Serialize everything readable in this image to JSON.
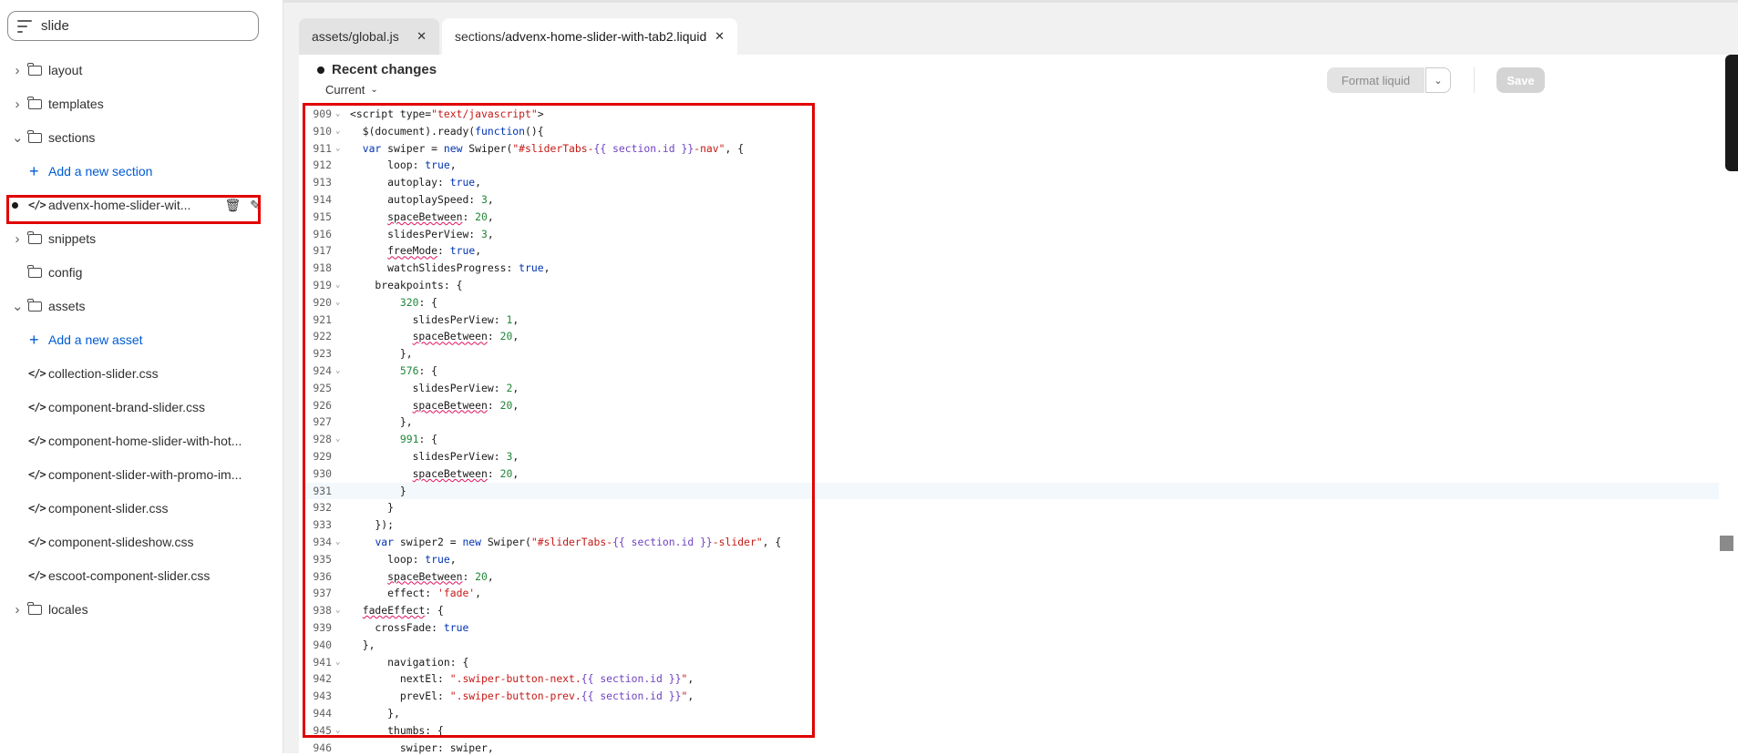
{
  "sidebar": {
    "search_value": "slide",
    "items": [
      {
        "type": "folder",
        "label": "layout",
        "chevron": "›"
      },
      {
        "type": "folder",
        "label": "templates",
        "chevron": "›"
      },
      {
        "type": "folder",
        "label": "sections",
        "chevron": "⌄"
      },
      {
        "type": "add",
        "label": "Add a new section"
      },
      {
        "type": "file",
        "label": "advenx-home-slider-wit..."
      },
      {
        "type": "folder",
        "label": "snippets",
        "chevron": "›"
      },
      {
        "type": "folder",
        "label": "config",
        "chevron": ""
      },
      {
        "type": "folder",
        "label": "assets",
        "chevron": "⌄"
      },
      {
        "type": "add",
        "label": "Add a new asset"
      },
      {
        "type": "file",
        "label": "collection-slider.css"
      },
      {
        "type": "file",
        "label": "component-brand-slider.css"
      },
      {
        "type": "file",
        "label": "component-home-slider-with-hot..."
      },
      {
        "type": "file",
        "label": "component-slider-with-promo-im..."
      },
      {
        "type": "file",
        "label": "component-slider.css"
      },
      {
        "type": "file",
        "label": "component-slideshow.css"
      },
      {
        "type": "file",
        "label": "escoot-component-slider.css"
      },
      {
        "type": "folder",
        "label": "locales",
        "chevron": "›"
      }
    ]
  },
  "tabs": [
    {
      "prefix": "assets/",
      "name": "global.js"
    },
    {
      "prefix": "sections/",
      "name": "advenx-home-slider-with-tab2.liquid"
    }
  ],
  "editor": {
    "recent_changes": "Recent changes",
    "current_label": "Current",
    "format_label": "Format liquid",
    "save_label": "Save"
  },
  "code_lines": [
    {
      "n": "909",
      "fold": true,
      "html": "&lt;script type=<span class='s'>\"text/javascript\"</span>&gt;"
    },
    {
      "n": "910",
      "fold": true,
      "html": "  $(document).ready(<span class='k'>function</span>(){"
    },
    {
      "n": "911",
      "fold": true,
      "html": "  <span class='k'>var</span> swiper = <span class='k'>new</span> Swiper(<span class='s'>\"#sliderTabs-</span><span class='p'>{{ section.id }}</span><span class='s'>-nav\"</span>, {"
    },
    {
      "n": "912",
      "fold": false,
      "html": "      loop: <span class='k'>true</span>,"
    },
    {
      "n": "913",
      "fold": false,
      "html": "      autoplay: <span class='k'>true</span>,"
    },
    {
      "n": "914",
      "fold": false,
      "html": "      autoplaySpeed: <span class='g'>3</span>,"
    },
    {
      "n": "915",
      "fold": false,
      "html": "      <span class='u'>spaceBetween</span>: <span class='g'>20</span>,"
    },
    {
      "n": "916",
      "fold": false,
      "html": "      slidesPerView: <span class='g'>3</span>,"
    },
    {
      "n": "917",
      "fold": false,
      "html": "      <span class='u'>freeMode</span>: <span class='k'>true</span>,"
    },
    {
      "n": "918",
      "fold": false,
      "html": "      watchSlidesProgress: <span class='k'>true</span>,"
    },
    {
      "n": "919",
      "fold": true,
      "html": "    breakpoints: {"
    },
    {
      "n": "920",
      "fold": true,
      "html": "        <span class='g'>320</span>: {"
    },
    {
      "n": "921",
      "fold": false,
      "html": "          slidesPerView: <span class='g'>1</span>,"
    },
    {
      "n": "922",
      "fold": false,
      "html": "          <span class='u'>spaceBetween</span>: <span class='g'>20</span>,"
    },
    {
      "n": "923",
      "fold": false,
      "html": "        },"
    },
    {
      "n": "924",
      "fold": true,
      "html": "        <span class='g'>576</span>: {"
    },
    {
      "n": "925",
      "fold": false,
      "html": "          slidesPerView: <span class='g'>2</span>,"
    },
    {
      "n": "926",
      "fold": false,
      "html": "          <span class='u'>spaceBetween</span>: <span class='g'>20</span>,"
    },
    {
      "n": "927",
      "fold": false,
      "html": "        },"
    },
    {
      "n": "928",
      "fold": true,
      "html": "        <span class='g'>991</span>: {"
    },
    {
      "n": "929",
      "fold": false,
      "html": "          slidesPerView: <span class='g'>3</span>,"
    },
    {
      "n": "930",
      "fold": false,
      "html": "          <span class='u'>spaceBetween</span>: <span class='g'>20</span>,"
    },
    {
      "n": "931",
      "fold": false,
      "cur": true,
      "html": "        }"
    },
    {
      "n": "932",
      "fold": false,
      "html": "      }"
    },
    {
      "n": "933",
      "fold": false,
      "html": "    });"
    },
    {
      "n": "934",
      "fold": true,
      "html": "    <span class='k'>var</span> swiper2 = <span class='k'>new</span> Swiper(<span class='s'>\"#sliderTabs-</span><span class='p'>{{ section.id }}</span><span class='s'>-slider\"</span>, {"
    },
    {
      "n": "935",
      "fold": false,
      "html": "      loop: <span class='k'>true</span>,"
    },
    {
      "n": "936",
      "fold": false,
      "html": "      <span class='u'>spaceBetween</span>: <span class='g'>20</span>,"
    },
    {
      "n": "937",
      "fold": false,
      "html": "      effect: <span class='s'>'fade'</span>,"
    },
    {
      "n": "938",
      "fold": true,
      "html": "  <span class='u'>fadeEffect</span>: {"
    },
    {
      "n": "939",
      "fold": false,
      "html": "    crossFade: <span class='k'>true</span>"
    },
    {
      "n": "940",
      "fold": false,
      "html": "  },"
    },
    {
      "n": "941",
      "fold": true,
      "html": "      navigation: {"
    },
    {
      "n": "942",
      "fold": false,
      "html": "        nextEl: <span class='s'>\".swiper-button-next.</span><span class='p'>{{ section.id }}</span><span class='s'>\"</span>,"
    },
    {
      "n": "943",
      "fold": false,
      "html": "        prevEl: <span class='s'>\".swiper-button-prev.</span><span class='p'>{{ section.id }}</span><span class='s'>\"</span>,"
    },
    {
      "n": "944",
      "fold": false,
      "html": "      },"
    },
    {
      "n": "945",
      "fold": true,
      "html": "      thumbs: {"
    },
    {
      "n": "946",
      "fold": false,
      "html": "        swiper: swiper,"
    }
  ]
}
